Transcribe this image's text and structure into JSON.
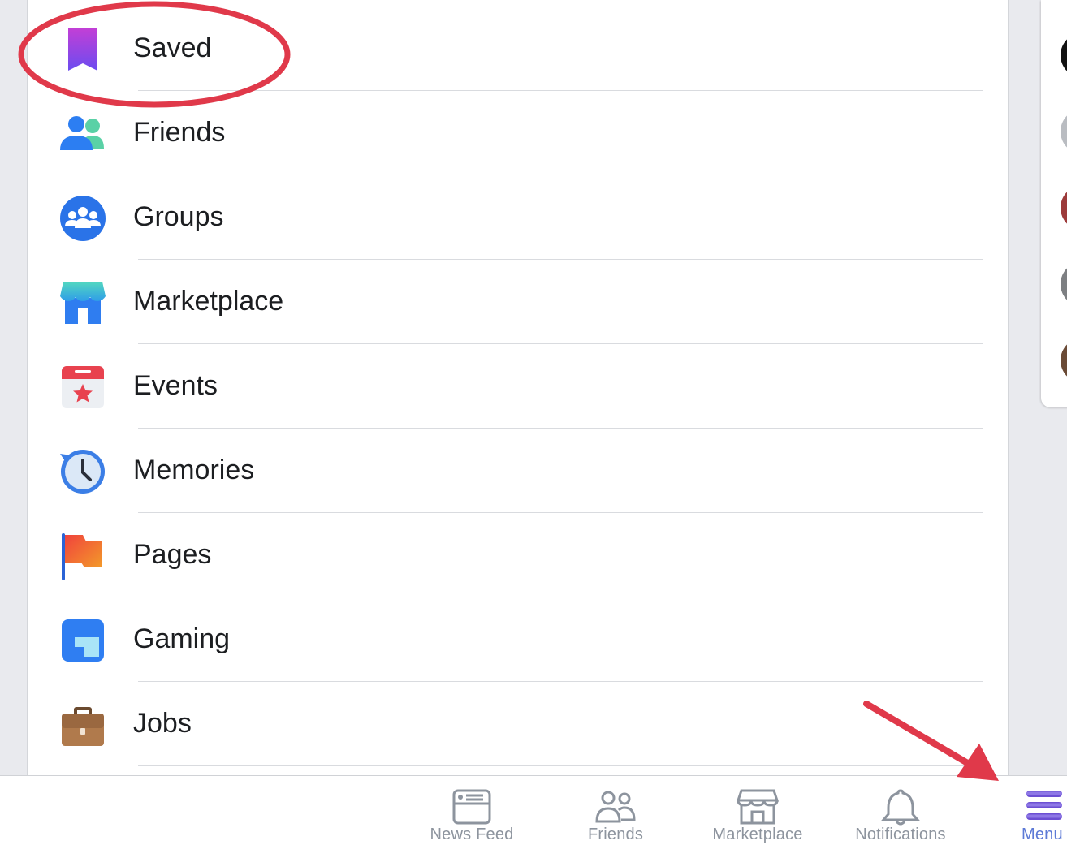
{
  "menu": {
    "items": [
      {
        "label": "Saved",
        "icon": "bookmark-icon"
      },
      {
        "label": "Friends",
        "icon": "friends-icon"
      },
      {
        "label": "Groups",
        "icon": "groups-icon"
      },
      {
        "label": "Marketplace",
        "icon": "marketplace-icon"
      },
      {
        "label": "Events",
        "icon": "calendar-star-icon"
      },
      {
        "label": "Memories",
        "icon": "clock-history-icon"
      },
      {
        "label": "Pages",
        "icon": "flag-icon"
      },
      {
        "label": "Gaming",
        "icon": "gaming-icon"
      },
      {
        "label": "Jobs",
        "icon": "briefcase-icon"
      }
    ]
  },
  "tabbar": {
    "tabs": [
      {
        "label": "News Feed",
        "icon": "news-feed-icon"
      },
      {
        "label": "Friends",
        "icon": "friends-outline-icon"
      },
      {
        "label": "Marketplace",
        "icon": "shop-icon"
      },
      {
        "label": "Notifications",
        "icon": "bell-icon"
      },
      {
        "label": "Menu",
        "icon": "hamburger-icon",
        "active": true
      }
    ]
  },
  "colors": {
    "annotation_red": "#e0394a",
    "active_tab": "#5d7ad6",
    "inactive_tab": "#8d949e"
  }
}
